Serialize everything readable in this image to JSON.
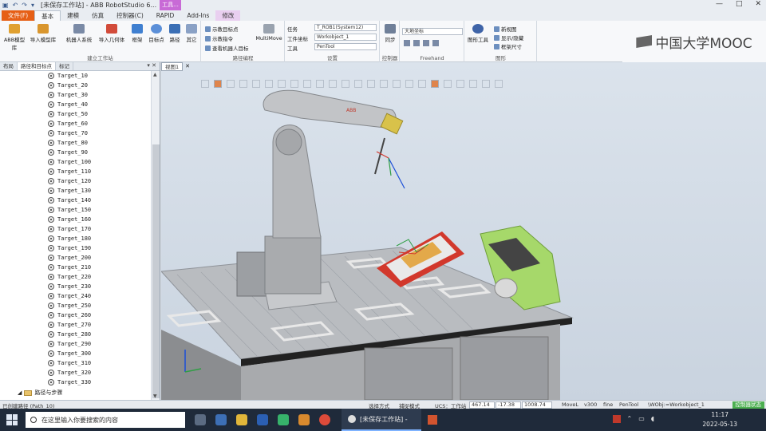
{
  "titlebar": {
    "title": "[未保存工作站] - ABB RobotStudio 6...",
    "context_tab": "工具...",
    "window_buttons": [
      "—",
      "□",
      "✕"
    ]
  },
  "tabs": [
    {
      "label": "文件(F)",
      "kind": "file"
    },
    {
      "label": "基本",
      "kind": "active"
    },
    {
      "label": "建模",
      "kind": "normal"
    },
    {
      "label": "仿真",
      "kind": "normal"
    },
    {
      "label": "控制器(C)",
      "kind": "normal"
    },
    {
      "label": "RAPID",
      "kind": "normal"
    },
    {
      "label": "Add-Ins",
      "kind": "normal"
    },
    {
      "label": "修改",
      "kind": "modify"
    }
  ],
  "ribbon": {
    "build_station": {
      "label": "建立工作站",
      "buttons": [
        "ABB模型库",
        "导入模型库",
        "机器人系统",
        "导入几何体",
        "框架",
        "目标点",
        "路径",
        "其它"
      ]
    },
    "path_programming": {
      "label": "路径编程",
      "items": [
        "示教目标点",
        "示教指令",
        "查看机器人目标",
        "MultiMove"
      ]
    },
    "settings": {
      "label": "设置",
      "task_label": "任务",
      "task_value": "T_ROB1(System12)",
      "wobj_label": "工件坐标",
      "wobj_value": "Workobject_1",
      "tool_label": "工具",
      "tool_value": "PenTool"
    },
    "controller": {
      "label": "控制器",
      "button": "同步"
    },
    "freehand": {
      "label": "Freehand",
      "coord_value": "大地坐标"
    },
    "graphics": {
      "label": "图形",
      "button": "图形工具",
      "items": [
        "新视图",
        "显示/隐藏",
        "框架尺寸"
      ]
    }
  },
  "mooc": {
    "text": "中国大学MOOC"
  },
  "left_panel": {
    "tabs": [
      "布局",
      "路径和目标点",
      "标记"
    ],
    "targets": [
      "Target_10",
      "Target_20",
      "Target_30",
      "Target_40",
      "Target_50",
      "Target_60",
      "Target_70",
      "Target_80",
      "Target_90",
      "Target_100",
      "Target_110",
      "Target_120",
      "Target_130",
      "Target_140",
      "Target_150",
      "Target_160",
      "Target_170",
      "Target_180",
      "Target_190",
      "Target_200",
      "Target_210",
      "Target_220",
      "Target_230",
      "Target_240",
      "Target_250",
      "Target_260",
      "Target_270",
      "Target_280",
      "Target_290",
      "Target_300",
      "Target_310",
      "Target_320",
      "Target_330"
    ],
    "folder": "路径与步骤"
  },
  "view": {
    "tab": "视图1",
    "close": "✕"
  },
  "robot": {
    "brand": "ABB"
  },
  "statusbar": {
    "left": "已创建路径 (Path_10)",
    "select_mode": "选择方式",
    "snap_mode": "捕捉模式",
    "ucs": "UCS：工作站",
    "x": "467.14",
    "y": "-17.38",
    "z": "1008.74",
    "motion": "MoveL",
    "speed": "v300",
    "zone": "fine",
    "tool": "PenTool",
    "wobj": "\\WObj:=Workobject_1",
    "controller_status": "控制器状态"
  },
  "taskbar": {
    "search_placeholder": "在这里输入你要搜索的内容",
    "active_app": "[未保存工作站] -",
    "time": "11:17",
    "date": "2022-05-13"
  }
}
